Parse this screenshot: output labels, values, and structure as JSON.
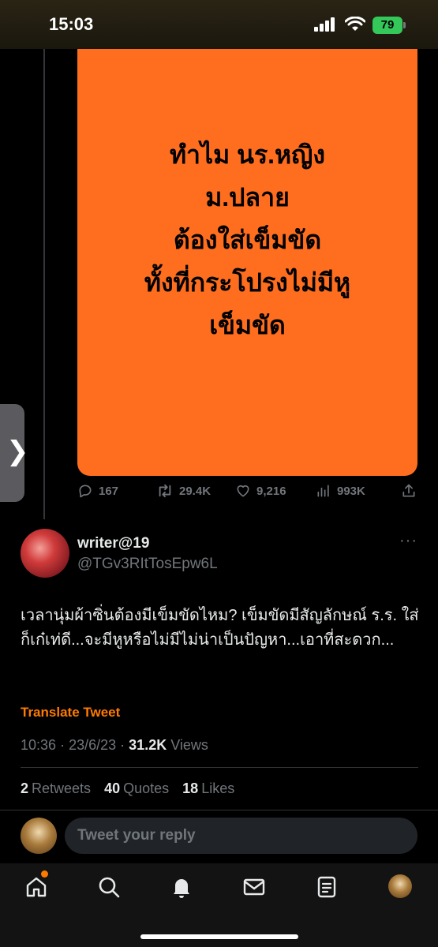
{
  "status_bar": {
    "time": "15:03",
    "battery": "79"
  },
  "previous_tweet": {
    "image_text_lines": [
      "ทำไม นร.หญิง",
      "ม.ปลาย",
      "ต้องใส่เข็มขัด",
      "ทั้งที่กระโปรงไม่มีหู",
      "เข็มขัด"
    ],
    "image_background": "#ff6d1f",
    "actions": {
      "replies": "167",
      "retweets": "29.4K",
      "likes": "9,216",
      "views": "993K"
    }
  },
  "tweet": {
    "display_name": "writer@19",
    "handle": "@TGv3RItTosEpw6L",
    "more_label": "···",
    "text": "เวลานุ่มผ้าซิ่นต้องมีเข็มขัดไหม? เข็มขัดมีสัญลักษณ์ ร.ร. ใส่ก็เก๋เท่ดี...จะมีหูหรือไม่มีไม่น่าเป็นปัญหา...เอาที่สะดวก...",
    "translate_label": "Translate Tweet",
    "time": "10:36",
    "date": "23/6/23",
    "views_count": "31.2K",
    "views_label": "Views",
    "separator": "·",
    "retweets_count": "2",
    "retweets_label": "Retweets",
    "quotes_count": "40",
    "quotes_label": "Quotes",
    "likes_count": "18",
    "likes_label": "Likes"
  },
  "reply": {
    "placeholder": "Tweet your reply"
  },
  "side_handle": {
    "glyph": "❯"
  },
  "tabbar": {
    "icons": [
      "home-icon",
      "search-icon",
      "bell-icon",
      "mail-icon",
      "lists-icon",
      "profile-avatar"
    ]
  },
  "colors": {
    "accent": "#ff7a00",
    "background": "#000000",
    "secondary_text": "#71767b"
  }
}
